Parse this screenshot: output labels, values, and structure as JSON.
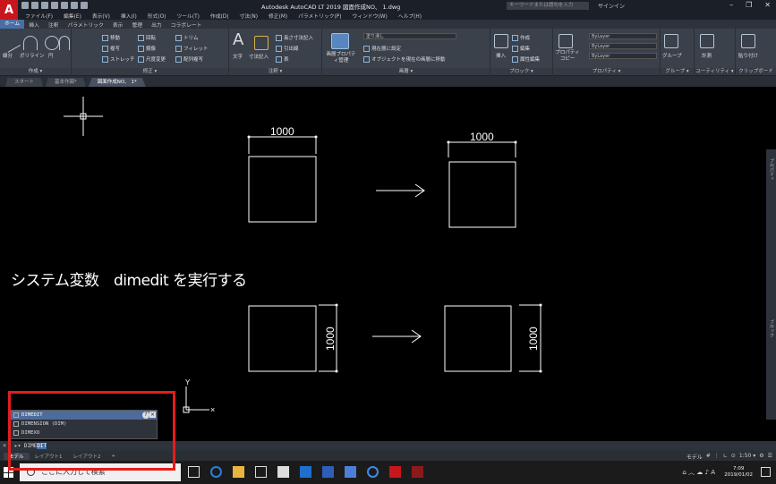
{
  "app": {
    "logo": "A",
    "title": "Autodesk AutoCAD LT 2019 図面作成NO、 1.dwg",
    "search_placeholder": "キーワードまたは語句を入力",
    "signin": "サインイン",
    "window_controls": [
      "–",
      "❐",
      "✕"
    ]
  },
  "menubar": [
    "ファイル(F)",
    "編集(E)",
    "表示(V)",
    "挿入(I)",
    "形式(O)",
    "ツール(T)",
    "作成(D)",
    "寸法(N)",
    "修正(M)",
    "パラメトリック(P)",
    "ウィンドウ(W)",
    "ヘルプ(H)"
  ],
  "ribbon_tabs": [
    "ホーム",
    "挿入",
    "注釈",
    "パラメトリック",
    "表示",
    "管理",
    "出力",
    "コラボレート"
  ],
  "ribbon": {
    "draw_panel": {
      "title": "作成 ▾",
      "tools": [
        "線分",
        "ポリライン",
        "円",
        "円弧"
      ]
    },
    "modify_panel": {
      "title": "修正 ▾",
      "tools": [
        "移動",
        "回転",
        "トリム",
        "複写",
        "鏡像",
        "フィレット",
        "ストレッチ",
        "尺度変更",
        "配列複写"
      ]
    },
    "annotation_panel": {
      "title": "注釈 ▾",
      "tools": [
        "文字",
        "寸法記入",
        "長さ寸法記入",
        "引出線",
        "表"
      ]
    },
    "layer_panel": {
      "title": "画層 ▾",
      "tools": [
        "画層プロパティ管理",
        "塗り潰し",
        "現在層に設定",
        "オブジェクトを現在の画層に移動"
      ]
    },
    "block_panel": {
      "title": "ブロック ▾",
      "tools": [
        "挿入",
        "作成",
        "編集",
        "属性編集"
      ]
    },
    "properties_panel": {
      "title": "プロパティ ▾",
      "tools": [
        "プロパティコピー",
        "ByLayer",
        "ByLayer",
        "ByLayer"
      ]
    },
    "group_panel": {
      "title": "グループ ▾",
      "tools": [
        "グループ"
      ]
    },
    "utility_panel": {
      "title": "ユーティリティ ▾",
      "tools": [
        "計測"
      ]
    },
    "clipboard_panel": {
      "title": "クリップボード",
      "tools": [
        "貼り付け"
      ]
    }
  },
  "file_tabs": [
    "スタート",
    "基本作図*",
    "図面作成NO、 1*"
  ],
  "drawing": {
    "dim_top_left": "1000",
    "dim_top_right": "1000",
    "dim_bottom_left": "1000",
    "dim_bottom_right": "1000",
    "ucs_y": "Y"
  },
  "palette_strip": [
    "プロパティ",
    "ブロック"
  ],
  "instruction_text": "システム変数　dimedit を実行する",
  "autocomplete": {
    "items": [
      "DIMEDIT",
      "DIMENSION (DIM)",
      "DIMEXO"
    ],
    "help": "?",
    "close": "×"
  },
  "command_line": {
    "prefix": "▸▾",
    "typed": "DIME",
    "suggested": "DIT"
  },
  "layout_tabs": [
    "モデル",
    "レイアウト1",
    "レイアウト2",
    "+"
  ],
  "status_bar": {
    "model": "モデル",
    "scale": "1:50 ▾"
  },
  "taskbar": {
    "search_placeholder": "ここに入力して検索",
    "time": "7:09",
    "date": "2019/01/02",
    "ime": "A"
  },
  "colors": {
    "annotation_red": "#e51c1c",
    "accent_blue": "#4a6fa5"
  }
}
